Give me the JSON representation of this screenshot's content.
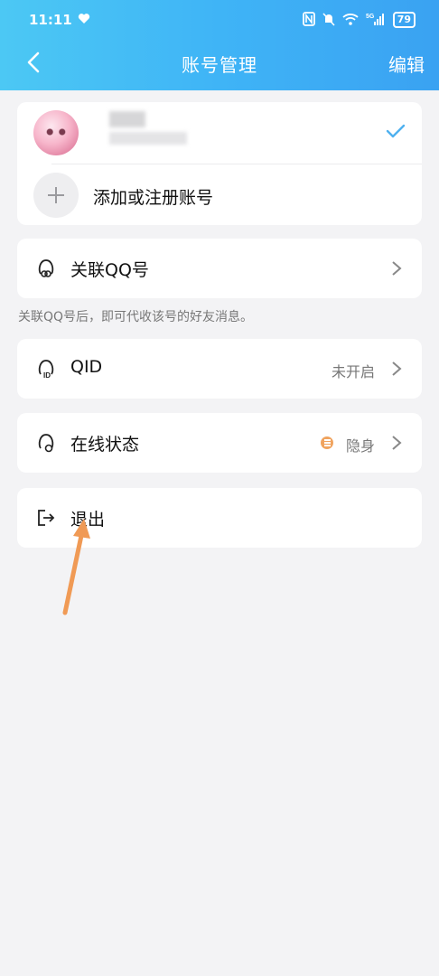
{
  "status_bar": {
    "time": "11:11",
    "network": "5G",
    "battery": "79"
  },
  "nav": {
    "title": "账号管理",
    "edit_label": "编辑"
  },
  "accounts": {
    "add_label": "添加或注册账号"
  },
  "rows": {
    "link_qq": {
      "label": "关联QQ号"
    },
    "link_hint": "关联QQ号后，即可代收该号的好友消息。",
    "qid": {
      "label": "QID",
      "value": "未开启"
    },
    "online_status": {
      "label": "在线状态",
      "value": "隐身"
    },
    "logout": {
      "label": "退出"
    }
  },
  "colors": {
    "header_gradient_start": "#4cc8f4",
    "header_gradient_end": "#3aa2f2",
    "check": "#4fb1ef",
    "status_dot": "#f0a35e",
    "annotation_arrow": "#f09a55"
  }
}
